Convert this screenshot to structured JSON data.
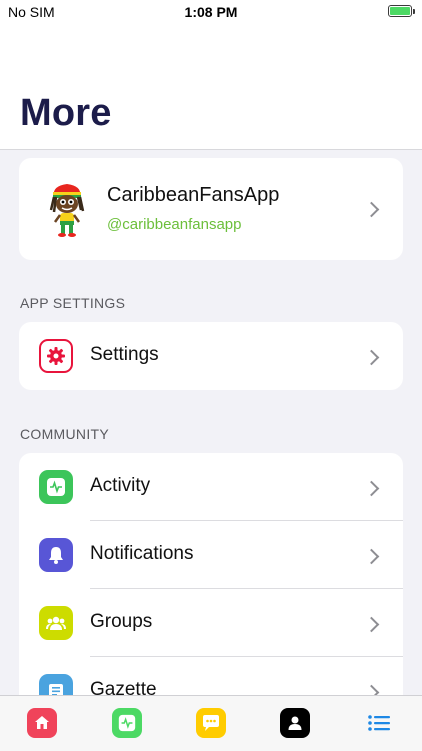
{
  "status": {
    "carrier": "No SIM",
    "time": "1:08 PM"
  },
  "header": {
    "title": "More"
  },
  "profile": {
    "name": "CaribbeanFansApp",
    "handle": "@caribbeanfansapp"
  },
  "sections": {
    "app_settings": {
      "title": "APP SETTINGS",
      "items": [
        {
          "label": "Settings",
          "icon": "gear-icon",
          "color": "#e8143c"
        }
      ]
    },
    "community": {
      "title": "COMMUNITY",
      "items": [
        {
          "label": "Activity",
          "icon": "activity-icon",
          "color": "#3cc55a"
        },
        {
          "label": "Notifications",
          "icon": "bell-icon",
          "color": "#5856d6"
        },
        {
          "label": "Groups",
          "icon": "groups-icon",
          "color": "#cddc00"
        },
        {
          "label": "Gazette",
          "icon": "gazette-icon",
          "color": "#4aa3df"
        }
      ]
    }
  },
  "tabbar": {
    "tabs": [
      {
        "icon": "home-icon",
        "color": "#f0435a"
      },
      {
        "icon": "activity-icon",
        "color": "#4cd964"
      },
      {
        "icon": "chat-icon",
        "color": "#ffcc00"
      },
      {
        "icon": "profile-icon",
        "color": "#000000"
      },
      {
        "icon": "menu-icon",
        "color": "#1e88e5",
        "active": true
      }
    ]
  }
}
